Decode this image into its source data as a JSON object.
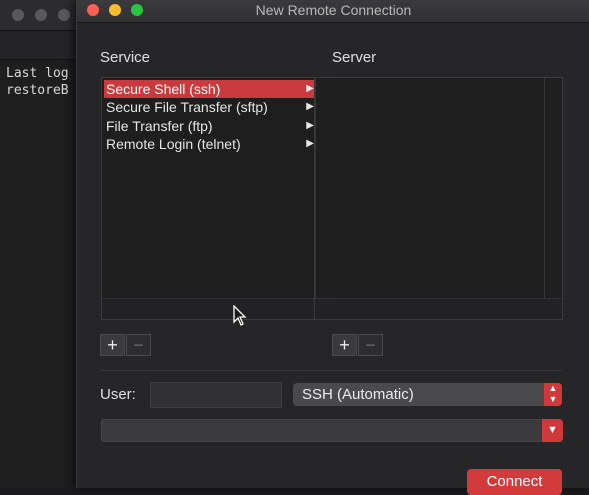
{
  "terminal": {
    "lines": [
      "Last log",
      "restoreB"
    ]
  },
  "dialog": {
    "title": "New Remote Connection",
    "service_label": "Service",
    "server_label": "Server",
    "services": [
      {
        "label": "Secure Shell (ssh)",
        "selected": true
      },
      {
        "label": "Secure File Transfer (sftp)",
        "selected": false
      },
      {
        "label": "File Transfer (ftp)",
        "selected": false
      },
      {
        "label": "Remote Login (telnet)",
        "selected": false
      }
    ],
    "add_symbol": "+",
    "remove_symbol": "−",
    "user_label": "User:",
    "user_value": "",
    "protocol_selected": "SSH (Automatic)",
    "command_value": "",
    "connect_label": "Connect"
  },
  "colors": {
    "accent": "#d33a3c",
    "background": "#262628"
  }
}
